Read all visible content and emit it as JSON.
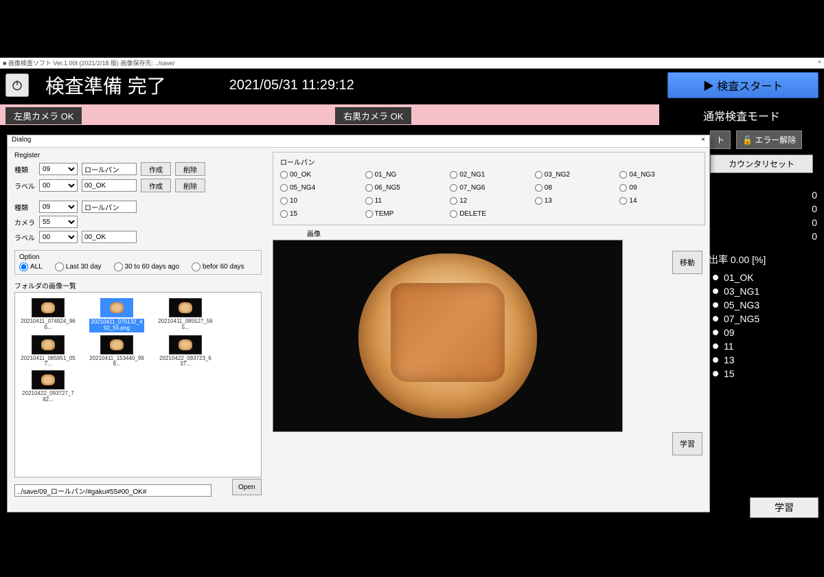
{
  "window": {
    "title": "■ 画像検査ソフト Ver.1.00t (2021/2/18 版) 画像保存先: ../save/",
    "close": "×"
  },
  "header": {
    "status_title": "検査準備 完了",
    "datetime": "2021/05/31 11:29:12",
    "start_button": "▶ 検査スタート"
  },
  "mode_label": "通常検査モード",
  "cameras": {
    "left": "左奥カメラ OK",
    "right": "右奥カメラ OK"
  },
  "side": {
    "btn_t": "ト",
    "btn_error_clear": "🔓 エラー解除",
    "btn_counter_reset": "カウンタリセット",
    "counters": [
      "0",
      "0",
      "0",
      "0"
    ],
    "rate_label": "出率 0.00 [%]",
    "legend": [
      "01_OK",
      "03_NG1",
      "05_NG3",
      "07_NG5",
      "09",
      "11",
      "13",
      "15"
    ],
    "learn_button": "学習"
  },
  "dialog": {
    "title": "Dialog",
    "close": "×",
    "register_title": "Register",
    "rows": {
      "type1_label": "種類",
      "type1_sel": "09",
      "type1_text": "ロールパン",
      "label1_label": "ラベル",
      "label1_sel": "00",
      "label1_text": "00_OK",
      "type2_label": "種類",
      "type2_sel": "09",
      "type2_text": "ロールパン",
      "cam_label": "カメラ",
      "cam_sel": "55",
      "label2_label": "ラベル",
      "label2_sel": "00",
      "label2_text": "00_OK"
    },
    "create_btn": "作成",
    "delete_btn": "削除",
    "option_title": "Option",
    "options": [
      "ALL",
      "Last 30 day",
      "30 to 60 days ago",
      "befor 60 days"
    ],
    "folder_title": "フォルダの画像一覧",
    "thumbs": [
      {
        "label": "20210411_074924_966..."
      },
      {
        "label": "20210411_075132_492_55.png",
        "selected": true
      },
      {
        "label": "20210411_085527_565..."
      },
      {
        "label": "20210411_085951_057..."
      },
      {
        "label": "20210411_153440_996..."
      },
      {
        "label": "20210422_093723_637..."
      },
      {
        "label": "20210422_093727_782..."
      }
    ],
    "path": "../save/09_ロールパン/#gaku#55#00_OK#",
    "open_btn": "Open",
    "category_title": "ロールパン",
    "categories": [
      "00_OK",
      "01_NG",
      "02_NG1",
      "03_NG2",
      "04_NG3",
      "05_NG4",
      "06_NG5",
      "07_NG6",
      "08",
      "09",
      "10",
      "11",
      "12",
      "13",
      "14",
      "15",
      "TEMP",
      "DELETE"
    ],
    "preview_label": "画像",
    "move_btn": "移動",
    "learn_btn": "学習"
  }
}
